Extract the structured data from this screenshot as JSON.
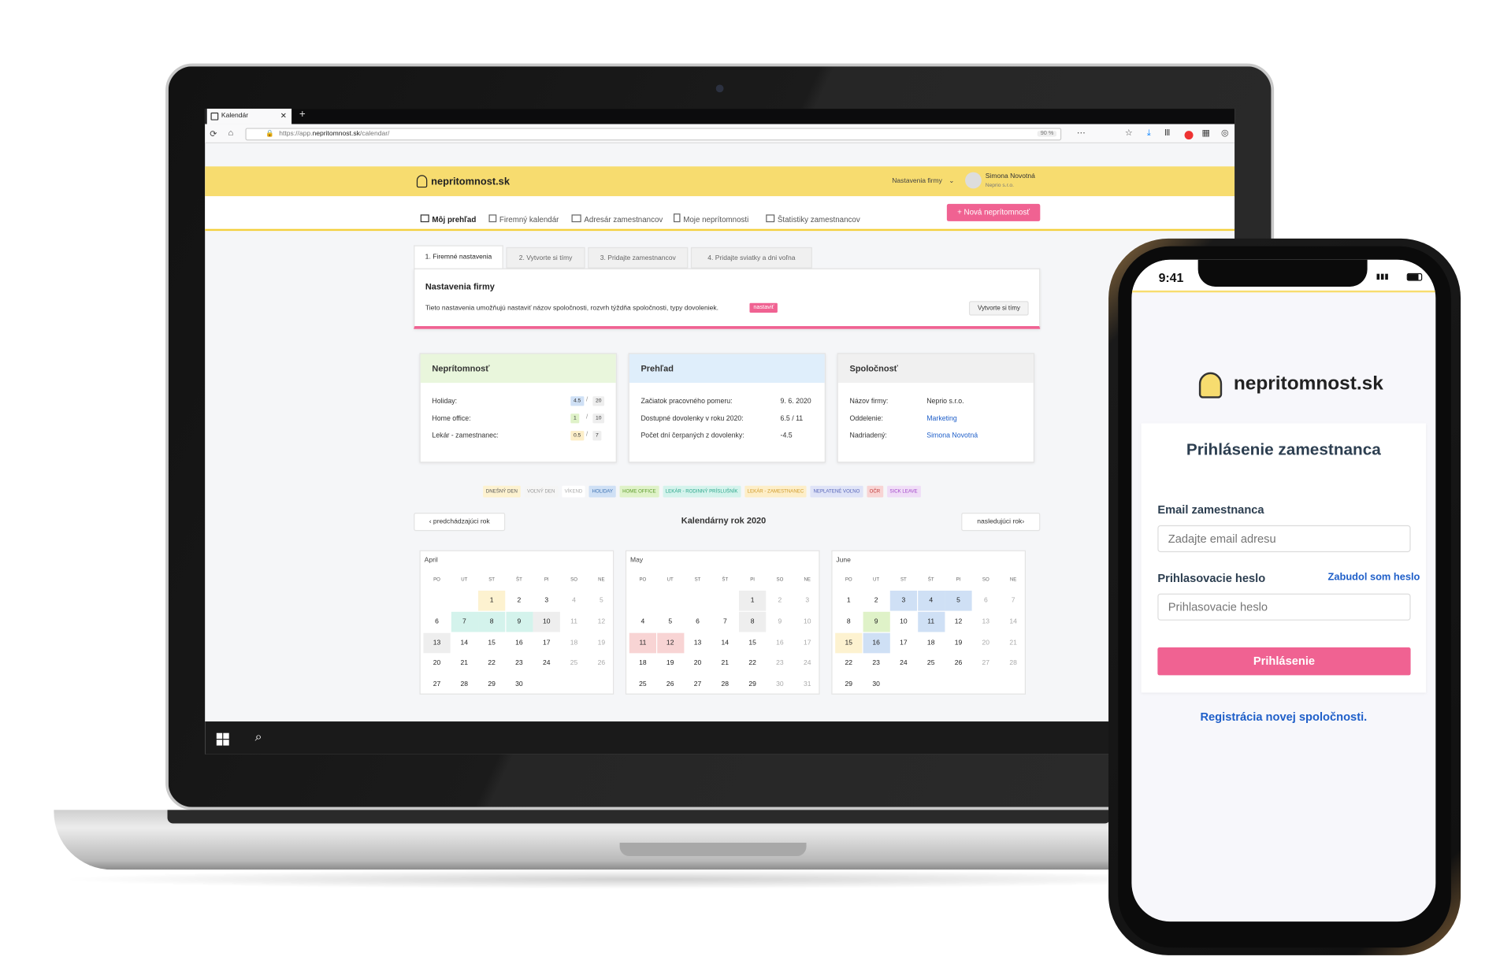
{
  "browser": {
    "tab_title": "Kalendár",
    "url_prefix": "https://app.",
    "url_domain": "nepritomnost.sk",
    "url_path": "/calendar/",
    "zoom": "90 %"
  },
  "app": {
    "logo": "nepritomnost.sk",
    "settings_menu": "Nastavenia firmy",
    "user_name": "Simona Novotná",
    "user_company": "Neprio s.r.o."
  },
  "nav": {
    "items": [
      "Môj prehľad",
      "Firemný kalendár",
      "Adresár zamestnancov",
      "Moje neprítomnosti",
      "Štatistiky zamestnancov"
    ],
    "new_button": "+ Nová neprítomnosť"
  },
  "setup": {
    "tabs": [
      "1. Firemné nastavenia",
      "2. Vytvorte si tímy",
      "3. Pridajte zamestnancov",
      "4. Pridajte sviatky a dni voľna"
    ],
    "title": "Nastavenia firmy",
    "text": "Tieto nastavenia umožňujú nastaviť názov spoločnosti, rozvrh týždňa spoločnosti, typy dovoleniek.",
    "set_badge": "nastaviť",
    "teams_button": "Vytvorte si tímy"
  },
  "cards": {
    "absence": {
      "title": "Neprítomnosť",
      "rows": [
        {
          "label": "Holiday:",
          "used": "4.5",
          "total": "20"
        },
        {
          "label": "Home office:",
          "used": "1",
          "total": "10"
        },
        {
          "label": "Lekár - zamestnanec:",
          "used": "0.5",
          "total": "7"
        }
      ]
    },
    "overview": {
      "title": "Prehľad",
      "rows": [
        {
          "label": "Začiatok pracovného pomeru:",
          "value": "9. 6. 2020"
        },
        {
          "label": "Dostupné dovolenky v roku 2020:",
          "value": "6.5 / 11"
        },
        {
          "label": "Počet dní čerpaných z dovolenky:",
          "value": "-4.5"
        }
      ]
    },
    "company": {
      "title": "Spoločnosť",
      "rows": [
        {
          "label": "Názov firmy:",
          "value": "Neprio s.r.o."
        },
        {
          "label": "Oddelenie:",
          "value": "Marketing"
        },
        {
          "label": "Nadriadený:",
          "value": "Simona Novotná"
        }
      ]
    }
  },
  "legend": [
    {
      "label": "DNEŠNÝ DEN",
      "bg": "#fdf2d0",
      "fg": "#555"
    },
    {
      "label": "VOĽNÝ DEN",
      "bg": "#f5f5f5",
      "fg": "#999"
    },
    {
      "label": "VÍKEND",
      "bg": "#ffffff",
      "fg": "#aaa"
    },
    {
      "label": "HOLIDAY",
      "bg": "#cfe0f5",
      "fg": "#3a6fb0"
    },
    {
      "label": "HOME OFFICE",
      "bg": "#dff2c8",
      "fg": "#5b9a2a"
    },
    {
      "label": "LEKÁR - RODINNÝ PRÍSLUŠNÍK",
      "bg": "#d4f3ec",
      "fg": "#2aa58a"
    },
    {
      "label": "LEKÁR - ZAMESTNANEC",
      "bg": "#fdeec8",
      "fg": "#d09a2a"
    },
    {
      "label": "NEPLATENÉ VOĽNO",
      "bg": "#dfe3f7",
      "fg": "#5563b8"
    },
    {
      "label": "OČR",
      "bg": "#f8d4d4",
      "fg": "#c03a3a"
    },
    {
      "label": "SICK LEAVE",
      "bg": "#f0ddf7",
      "fg": "#a044c8"
    }
  ],
  "calendar": {
    "prev": "predchádzajúci rok",
    "title": "Kalendárny rok 2020",
    "next": "nasledujúci rok",
    "day_names": [
      "PO",
      "UT",
      "ST",
      "ŠT",
      "PI",
      "SO",
      "NE"
    ],
    "months": [
      {
        "name": "April",
        "offset": 2,
        "days": 30,
        "colors": {
          "1": "#fdf2d0",
          "7": "#d4f3ec",
          "8": "#d4f3ec",
          "9": "#d4f3ec",
          "10": "#eeeeee",
          "13": "#eeeeee"
        }
      },
      {
        "name": "May",
        "offset": 4,
        "days": 31,
        "colors": {
          "1": "#eeeeee",
          "8": "#eeeeee",
          "11": "#f8d4d4",
          "12": "#f8d4d4"
        }
      },
      {
        "name": "June",
        "offset": 0,
        "days": 30,
        "colors": {
          "3": "#cfe0f5",
          "4": "#cfe0f5",
          "5": "#cfe0f5",
          "9": "#dff2c8",
          "11": "#cfe0f5",
          "15": "#fdf2d0",
          "16": "#cfe0f5"
        }
      }
    ]
  },
  "phone": {
    "time": "9:41",
    "logo": "nepritomnost.sk",
    "title": "Prihlásenie zamestnanca",
    "email_label": "Email zamestnanca",
    "email_placeholder": "Zadajte email adresu",
    "password_label": "Prihlasovacie heslo",
    "forgot": "Zabudol som heslo",
    "password_placeholder": "Prihlasovacie heslo",
    "login_button": "Prihlásenie",
    "register_link": "Registrácia novej spoločnosti."
  }
}
